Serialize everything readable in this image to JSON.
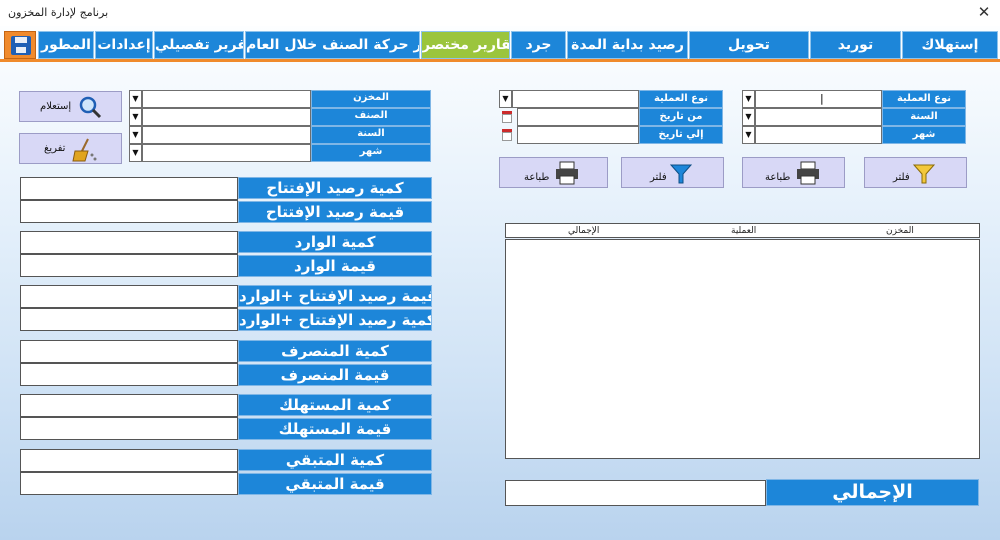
{
  "window": {
    "title": "برنامج لإدارة المخزون",
    "close_glyph": "✕"
  },
  "nav": [
    "إستهلاك",
    "توريد",
    "تحويل",
    "رصيد بداية المدة",
    "جرد",
    "تقارير مختصر",
    "تقرير حركة الصنف خلال العام",
    "تقرير تفصيلي",
    "إعدادات",
    "المطور"
  ],
  "right_filters": {
    "op_type_label": "نوع العملية",
    "year_label": "السنة",
    "month_label": "شهر",
    "op_type_value": "|",
    "filter_label": "فلتر",
    "print_label": "طباعة"
  },
  "mid_filters": {
    "op_type_label": "نوع العملية",
    "from_date_label": "من تاريخ",
    "to_date_label": "إلي تاريخ",
    "filter_label": "فلتر",
    "print_label": "طباعة"
  },
  "left_filters": {
    "store_label": "المخزن",
    "item_label": "الصنف",
    "year_label": "السنة",
    "month_label": "شهر",
    "query_label": "إستعلام",
    "clear_label": "تفريغ"
  },
  "summary": [
    [
      "كمية رصيد الإفتتاح",
      "قيمة رصيد الإفتتاح"
    ],
    [
      "كمية الوارد",
      "قيمة الوارد"
    ],
    [
      "قيمة رصيد الإفتتاح +الوارد",
      "كمية رصيد الإفتتاح +الوارد"
    ],
    [
      "كمية المنصرف",
      "قيمة المنصرف"
    ],
    [
      "كمية المستهلك",
      "قيمة المستهلك"
    ],
    [
      "كمية المتبقي",
      "قيمة المتبقي"
    ]
  ],
  "list": {
    "columns": [
      "المخزن",
      "العملية",
      "الإجمالي"
    ]
  },
  "total": {
    "label": "الإجمالي",
    "value": ""
  },
  "colors": {
    "accent": "#1d86d9",
    "active_tab": "#9bc53d",
    "orange": "#f08a2c"
  },
  "icons": [
    "save-icon",
    "search-icon",
    "broom-icon",
    "funnel-icon",
    "printer-icon",
    "calendar-icon",
    "chevron-down-icon"
  ]
}
